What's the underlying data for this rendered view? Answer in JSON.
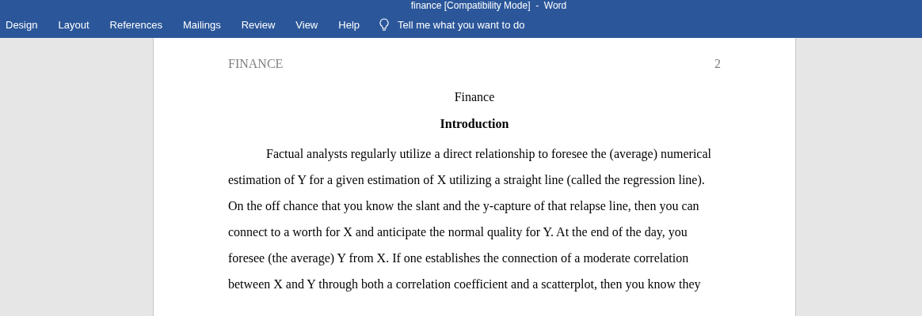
{
  "window": {
    "title": "finance [Compatibility Mode]  -  Word"
  },
  "ribbon_tabs": [
    {
      "label": "Design"
    },
    {
      "label": "Layout"
    },
    {
      "label": "References"
    },
    {
      "label": "Mailings"
    },
    {
      "label": "Review"
    },
    {
      "label": "View"
    },
    {
      "label": "Help"
    }
  ],
  "tell_me": {
    "placeholder": "Tell me what you want to do"
  },
  "document": {
    "header": {
      "running_head": "FINANCE",
      "page_number": "2"
    },
    "title": "Finance",
    "heading": "Introduction",
    "paragraph": "Factual analysts regularly utilize a direct relationship to foresee the (average) numerical estimation of Y for a given estimation of X utilizing a straight line (called the regression line). On the off chance that you know the slant and the y-capture of that relapse line, then you can connect to a worth for X and anticipate the normal quality for Y. At the end of the day, you foresee (the average) Y from X. If one establishes the connection of a moderate correlation between X and Y through both a correlation coefficient and a scatterplot, then you know they"
  }
}
